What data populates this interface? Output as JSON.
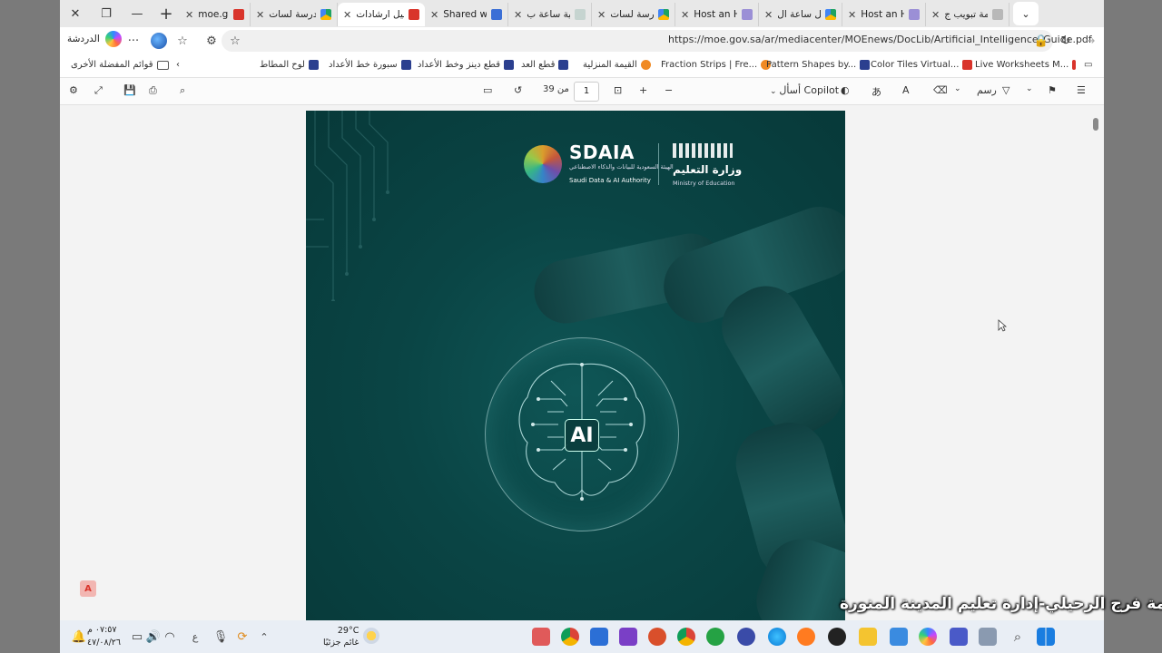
{
  "browser": {
    "tabs": [
      {
        "title": "علامة تبويب ج",
        "icon": "generic-tab-icon"
      },
      {
        "title": "Host an Hou",
        "icon": "tools-icon"
      },
      {
        "title": "تفعيل ساعة ال",
        "icon": "drive-icon"
      },
      {
        "title": "Host an Hou",
        "icon": "tools-icon"
      },
      {
        "title": "المدرسة لسات",
        "icon": "drive-icon"
      },
      {
        "title": "فعالية ساعة ب",
        "icon": "cloud-icon"
      },
      {
        "title": "Shared with n",
        "icon": "docs-icon"
      },
      {
        "title": "دليل ارشادات",
        "icon": "pdf-icon",
        "active": true
      },
      {
        "title": "المدرسة لسات",
        "icon": "drive-icon"
      },
      {
        "title": "moe.gov.sa/a",
        "icon": "pdf-icon"
      }
    ],
    "url": "https://moe.gov.sa/ar/mediacenter/MOEnews/DocLib/Artificial_Intelligence_Guide.pdf",
    "copilot_label": "الدردشة",
    "more_label": "···"
  },
  "bookmarks": {
    "other_favorites": "قوائم المفضلة الأخرى",
    "items": [
      "لوح المطاط",
      "سبورة خط الأعداد",
      "قطع دينز وخط الأعداد",
      "قطع العد",
      "القيمة المنزلية",
      "Fraction Strips | Fre...",
      "Pattern Shapes by...",
      "Color Tiles Virtual...",
      "Live Worksheets M..."
    ]
  },
  "pdf_toolbar": {
    "page_current": "1",
    "page_of": "من 39",
    "ask_copilot": "أسأل Copilot",
    "draw": "رسم"
  },
  "document": {
    "sdaia_name": "SDAIA",
    "sdaia_arabic": "الهيئة السعودية للبيانات والذكاء الاصطناعي",
    "sdaia_english": "Saudi Data & AI Authority",
    "moe_arabic": "وزارة التعليم",
    "moe_english": "Ministry of Education",
    "ai_label": "AI"
  },
  "taskbar": {
    "time": "٠٧:٥٧ م",
    "date": "٤٧/٠٨/٢٦",
    "temperature": "29°C",
    "weather_desc": "غائم جزئيًا",
    "lang": "ع"
  },
  "caption": "أفاطمة فرج الرحيلي-إدارة تعليم المدينة المنورة"
}
